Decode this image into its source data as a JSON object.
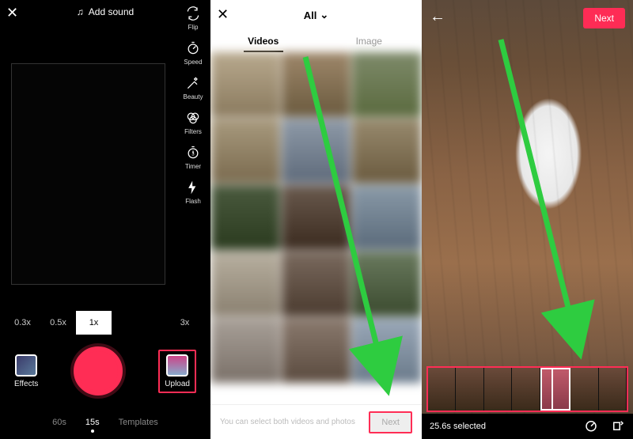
{
  "panel1": {
    "close_label": "✕",
    "add_sound": "Add sound",
    "rail": [
      {
        "icon": "flip-icon",
        "label": "Flip"
      },
      {
        "icon": "speed-icon",
        "label": "Speed"
      },
      {
        "icon": "beauty-icon",
        "label": "Beauty"
      },
      {
        "icon": "filters-icon",
        "label": "Filters"
      },
      {
        "icon": "timer-icon",
        "label": "Timer"
      },
      {
        "icon": "flash-icon",
        "label": "Flash"
      }
    ],
    "zoom": [
      "0.3x",
      "0.5x",
      "1x",
      "3x"
    ],
    "zoom_active": "1x",
    "effects_label": "Effects",
    "upload_label": "Upload",
    "modes": [
      "60s",
      "15s",
      "Templates"
    ],
    "mode_active": "15s"
  },
  "panel2": {
    "close_label": "✕",
    "album_label": "All",
    "tabs": {
      "videos": "Videos",
      "image": "Image"
    },
    "hint": "You can select both videos and photos",
    "next_label": "Next"
  },
  "panel3": {
    "back_label": "←",
    "next_label": "Next",
    "selected_label": "25.6s selected"
  }
}
